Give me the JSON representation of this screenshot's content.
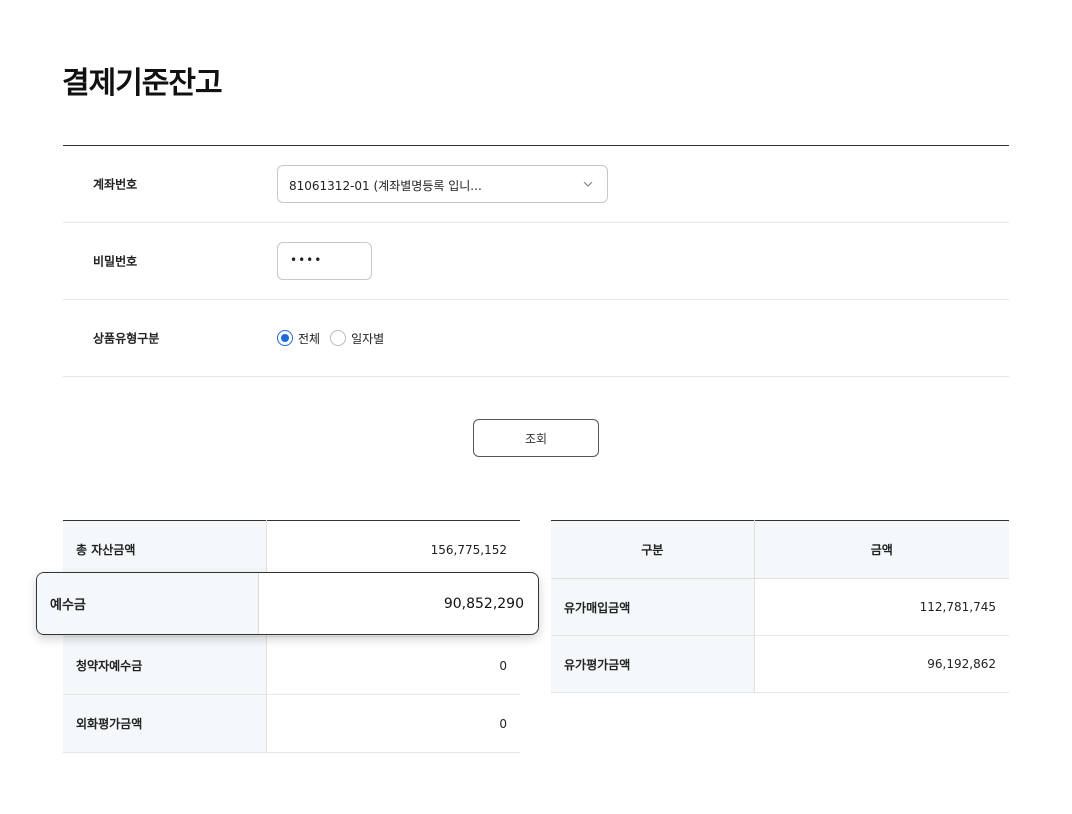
{
  "page": {
    "title": "결제기준잔고"
  },
  "form": {
    "account_label": "계좌번호",
    "account_value": "81061312-01 (계좌별명등록 입니...",
    "password_label": "비밀번호",
    "password_value": "••••",
    "product_type_label": "상품유형구분",
    "radio_options": [
      {
        "label": "전체",
        "selected": true
      },
      {
        "label": "일자별",
        "selected": false
      }
    ],
    "query_button": "조회"
  },
  "balance_table": {
    "rows": [
      {
        "label": "총 자산금액",
        "value": "156,775,152"
      },
      {
        "label": "예수금",
        "value": "90,852,290"
      },
      {
        "label": "청약자예수금",
        "value": "0"
      },
      {
        "label": "외화평가금액",
        "value": "0"
      }
    ]
  },
  "securities_table": {
    "headers": [
      "구분",
      "금액"
    ],
    "rows": [
      {
        "label": "유가매입금액",
        "value": "112,781,745"
      },
      {
        "label": "유가평가금액",
        "value": "96,192,862"
      }
    ]
  },
  "colors": {
    "accent": "#1e6ad8",
    "header_bg": "#f5f8fb"
  }
}
